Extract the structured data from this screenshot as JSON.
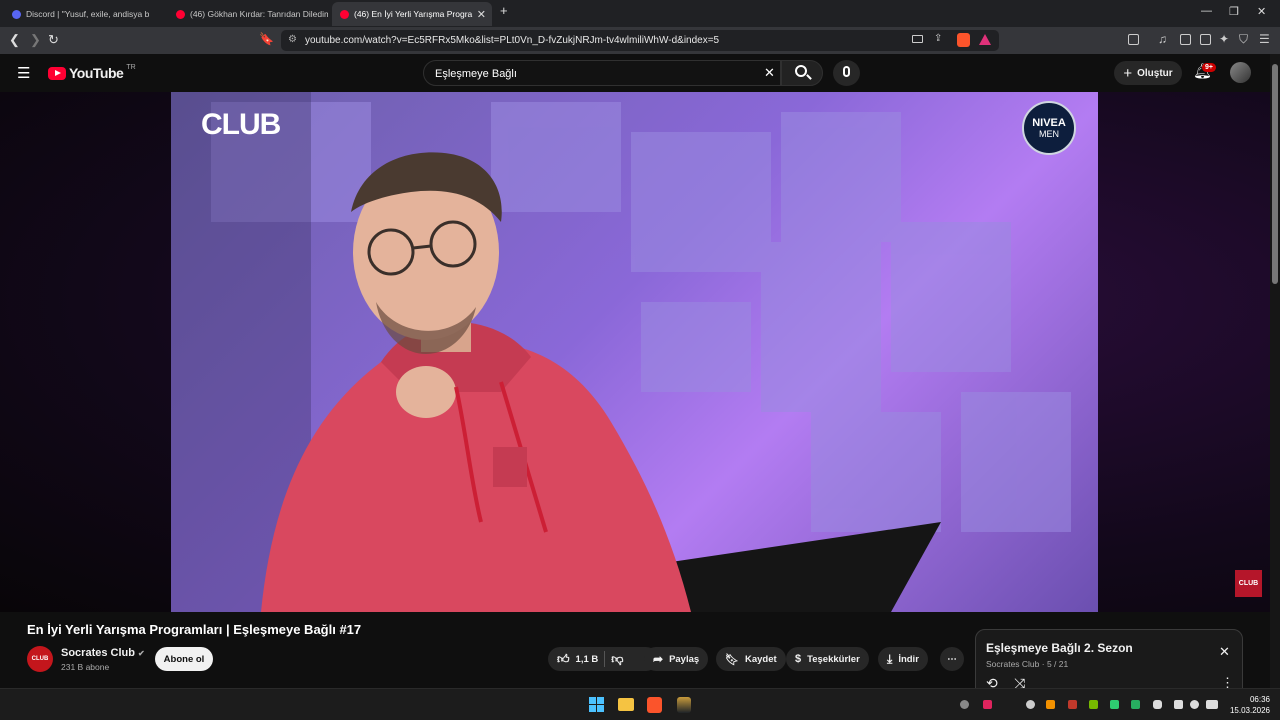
{
  "browser": {
    "tabs": [
      {
        "label": "Discord | \"Yusuf, exile, andisya b",
        "favicon_color": "#5865f2"
      },
      {
        "label": "(46) Gökhan Kırdar: Tanrıdan Diledim",
        "favicon_color": "#ff0033"
      },
      {
        "label": "(46) En İyi Yerli Yarışma Progra",
        "favicon_color": "#ff0033",
        "active": true
      }
    ],
    "new_tab_label": "+",
    "url": "youtube.com/watch?v=Ec5RFRx5Mko&list=PLt0Vn_D-fvZukjNRJm-tv4wlmiliWhW-d&index=5"
  },
  "youtube": {
    "logo_text": "YouTube",
    "region": "TR",
    "search_query": "Eşleşmeye Bağlı",
    "create_label": "Oluştur",
    "notification_count": "9+"
  },
  "video": {
    "watermark_left": "CLUB",
    "sponsor_line1": "NIVEA",
    "sponsor_line2": "MEN",
    "corner_logo": "CLUB"
  },
  "info": {
    "title": "En İyi Yerli Yarışma Programları | Eşleşmeye Bağlı #17",
    "channel_name": "Socrates Club",
    "subscribers": "231 B abone",
    "subscribe_label": "Abone ol",
    "avatar_text": "CLUB",
    "like_count": "1,1 B",
    "share_label": "Paylaş",
    "save_label": "Kaydet",
    "thanks_label": "Teşekkürler",
    "download_label": "İndir"
  },
  "playlist": {
    "title": "Eşleşmeye Bağlı 2. Sezon",
    "meta": "Socrates Club · 5 / 21"
  },
  "taskbar": {
    "time": "06:36",
    "date": "15.03.2026"
  },
  "colors": {
    "accent": "#ff0033",
    "hoodie": "#d9485f",
    "background": "#0f0f0f"
  }
}
